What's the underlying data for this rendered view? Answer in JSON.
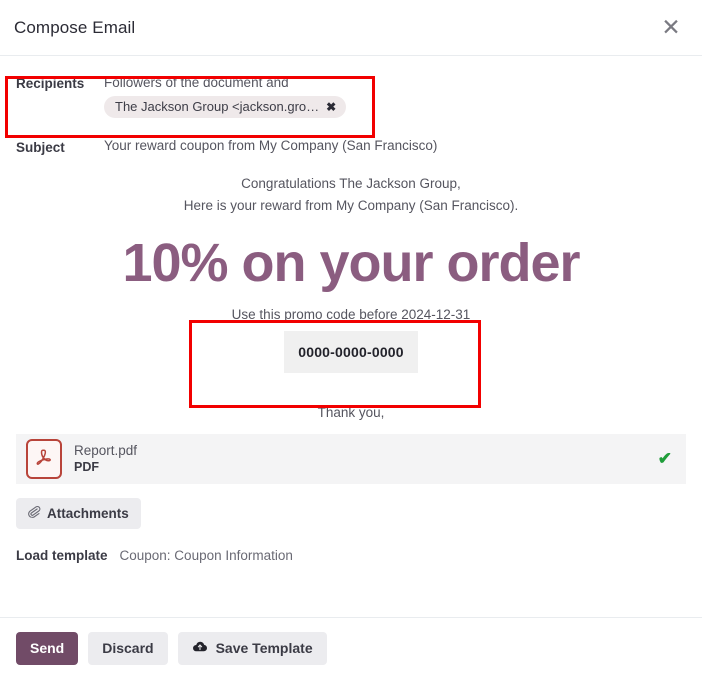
{
  "header": {
    "title": "Compose Email",
    "close_icon": "close-icon",
    "close_glyph": "✕"
  },
  "fields": {
    "recipients": {
      "label": "Recipients",
      "followers_text": "Followers of the document and",
      "chip": {
        "label": "The Jackson Group <jackson.gro…",
        "remove_glyph": "✖",
        "remove_icon": "remove-recipient-icon"
      }
    },
    "subject": {
      "label": "Subject",
      "value": "Your reward coupon from My Company (San Francisco)"
    }
  },
  "email_body": {
    "greeting_line1": "Congratulations The Jackson Group,",
    "greeting_line2": "Here is your reward from My Company (San Francisco).",
    "headline": "10% on your order",
    "promo_instruction": "Use this promo code before 2024-12-31",
    "promo_code": "0000-0000-0000",
    "closing": "Thank you,"
  },
  "attachment": {
    "icon": "pdf-file-icon",
    "name": "Report.pdf",
    "type": "PDF",
    "status_glyph": "✔",
    "status_icon": "upload-success-check-icon"
  },
  "attachments_button": {
    "label": "Attachments",
    "icon": "paperclip-icon",
    "icon_glyph": "✐"
  },
  "template": {
    "label": "Load template",
    "value": "Coupon: Coupon Information"
  },
  "footer": {
    "send_label": "Send",
    "discard_label": "Discard",
    "save_template_label": "Save Template",
    "save_template_icon": "cloud-upload-icon",
    "save_template_glyph": "☁"
  },
  "annotations": [
    {
      "name": "recipients-highlight",
      "color": "#f20000"
    },
    {
      "name": "promo-code-highlight",
      "color": "#f20000"
    }
  ],
  "colors": {
    "brand_purple": "#714b67",
    "headline_purple": "#8b5d80",
    "annotation_red": "#f20000",
    "success_green": "#1f9d3a",
    "pdf_red": "#b8443a"
  }
}
